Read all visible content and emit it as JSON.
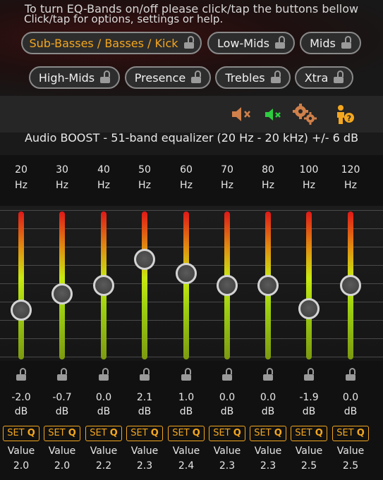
{
  "header": {
    "instruction": "To turn EQ-Bands on/off please click/tap the buttons bellow"
  },
  "band_buttons": [
    {
      "label": "Sub-Basses / Basses / Kick",
      "active": true
    },
    {
      "label": "Low-Mids",
      "active": false
    },
    {
      "label": "Mids",
      "active": false
    },
    {
      "label": "High-Mids",
      "active": false
    },
    {
      "label": "Presence",
      "active": false
    },
    {
      "label": "Trebles",
      "active": false
    },
    {
      "label": "Xtra",
      "active": false
    }
  ],
  "options": {
    "text": "Click/tap for options, settings or help.",
    "icons": [
      "speaker-mute-icon",
      "speaker-muted-green-icon",
      "gears-icon",
      "help-person-icon"
    ],
    "colors": {
      "accent": "#f4a71e",
      "mute_green": "#2ecc40"
    }
  },
  "title": "Audio BOOST - 51-band equalizer (20 Hz - 20 kHz) +/- 6 dB",
  "eq": {
    "freq_unit": "Hz",
    "gain_unit": "dB",
    "setq_label": "SET Q",
    "value_label": "Value",
    "range_db": [
      -6,
      6
    ],
    "bands": [
      {
        "freq": "20",
        "gain": "-2.0",
        "q": "2.0",
        "gain_num": -2.0
      },
      {
        "freq": "30",
        "gain": "-0.7",
        "q": "2.0",
        "gain_num": -0.7
      },
      {
        "freq": "40",
        "gain": "0.0",
        "q": "2.2",
        "gain_num": 0.0
      },
      {
        "freq": "50",
        "gain": "2.1",
        "q": "2.3",
        "gain_num": 2.1
      },
      {
        "freq": "60",
        "gain": "1.0",
        "q": "2.4",
        "gain_num": 1.0
      },
      {
        "freq": "70",
        "gain": "0.0",
        "q": "2.3",
        "gain_num": 0.0
      },
      {
        "freq": "80",
        "gain": "0.0",
        "q": "2.3",
        "gain_num": 0.0
      },
      {
        "freq": "100",
        "gain": "-1.9",
        "q": "2.5",
        "gain_num": -1.9
      },
      {
        "freq": "120",
        "gain": "0.0",
        "q": "2.5",
        "gain_num": 0.0
      }
    ]
  }
}
